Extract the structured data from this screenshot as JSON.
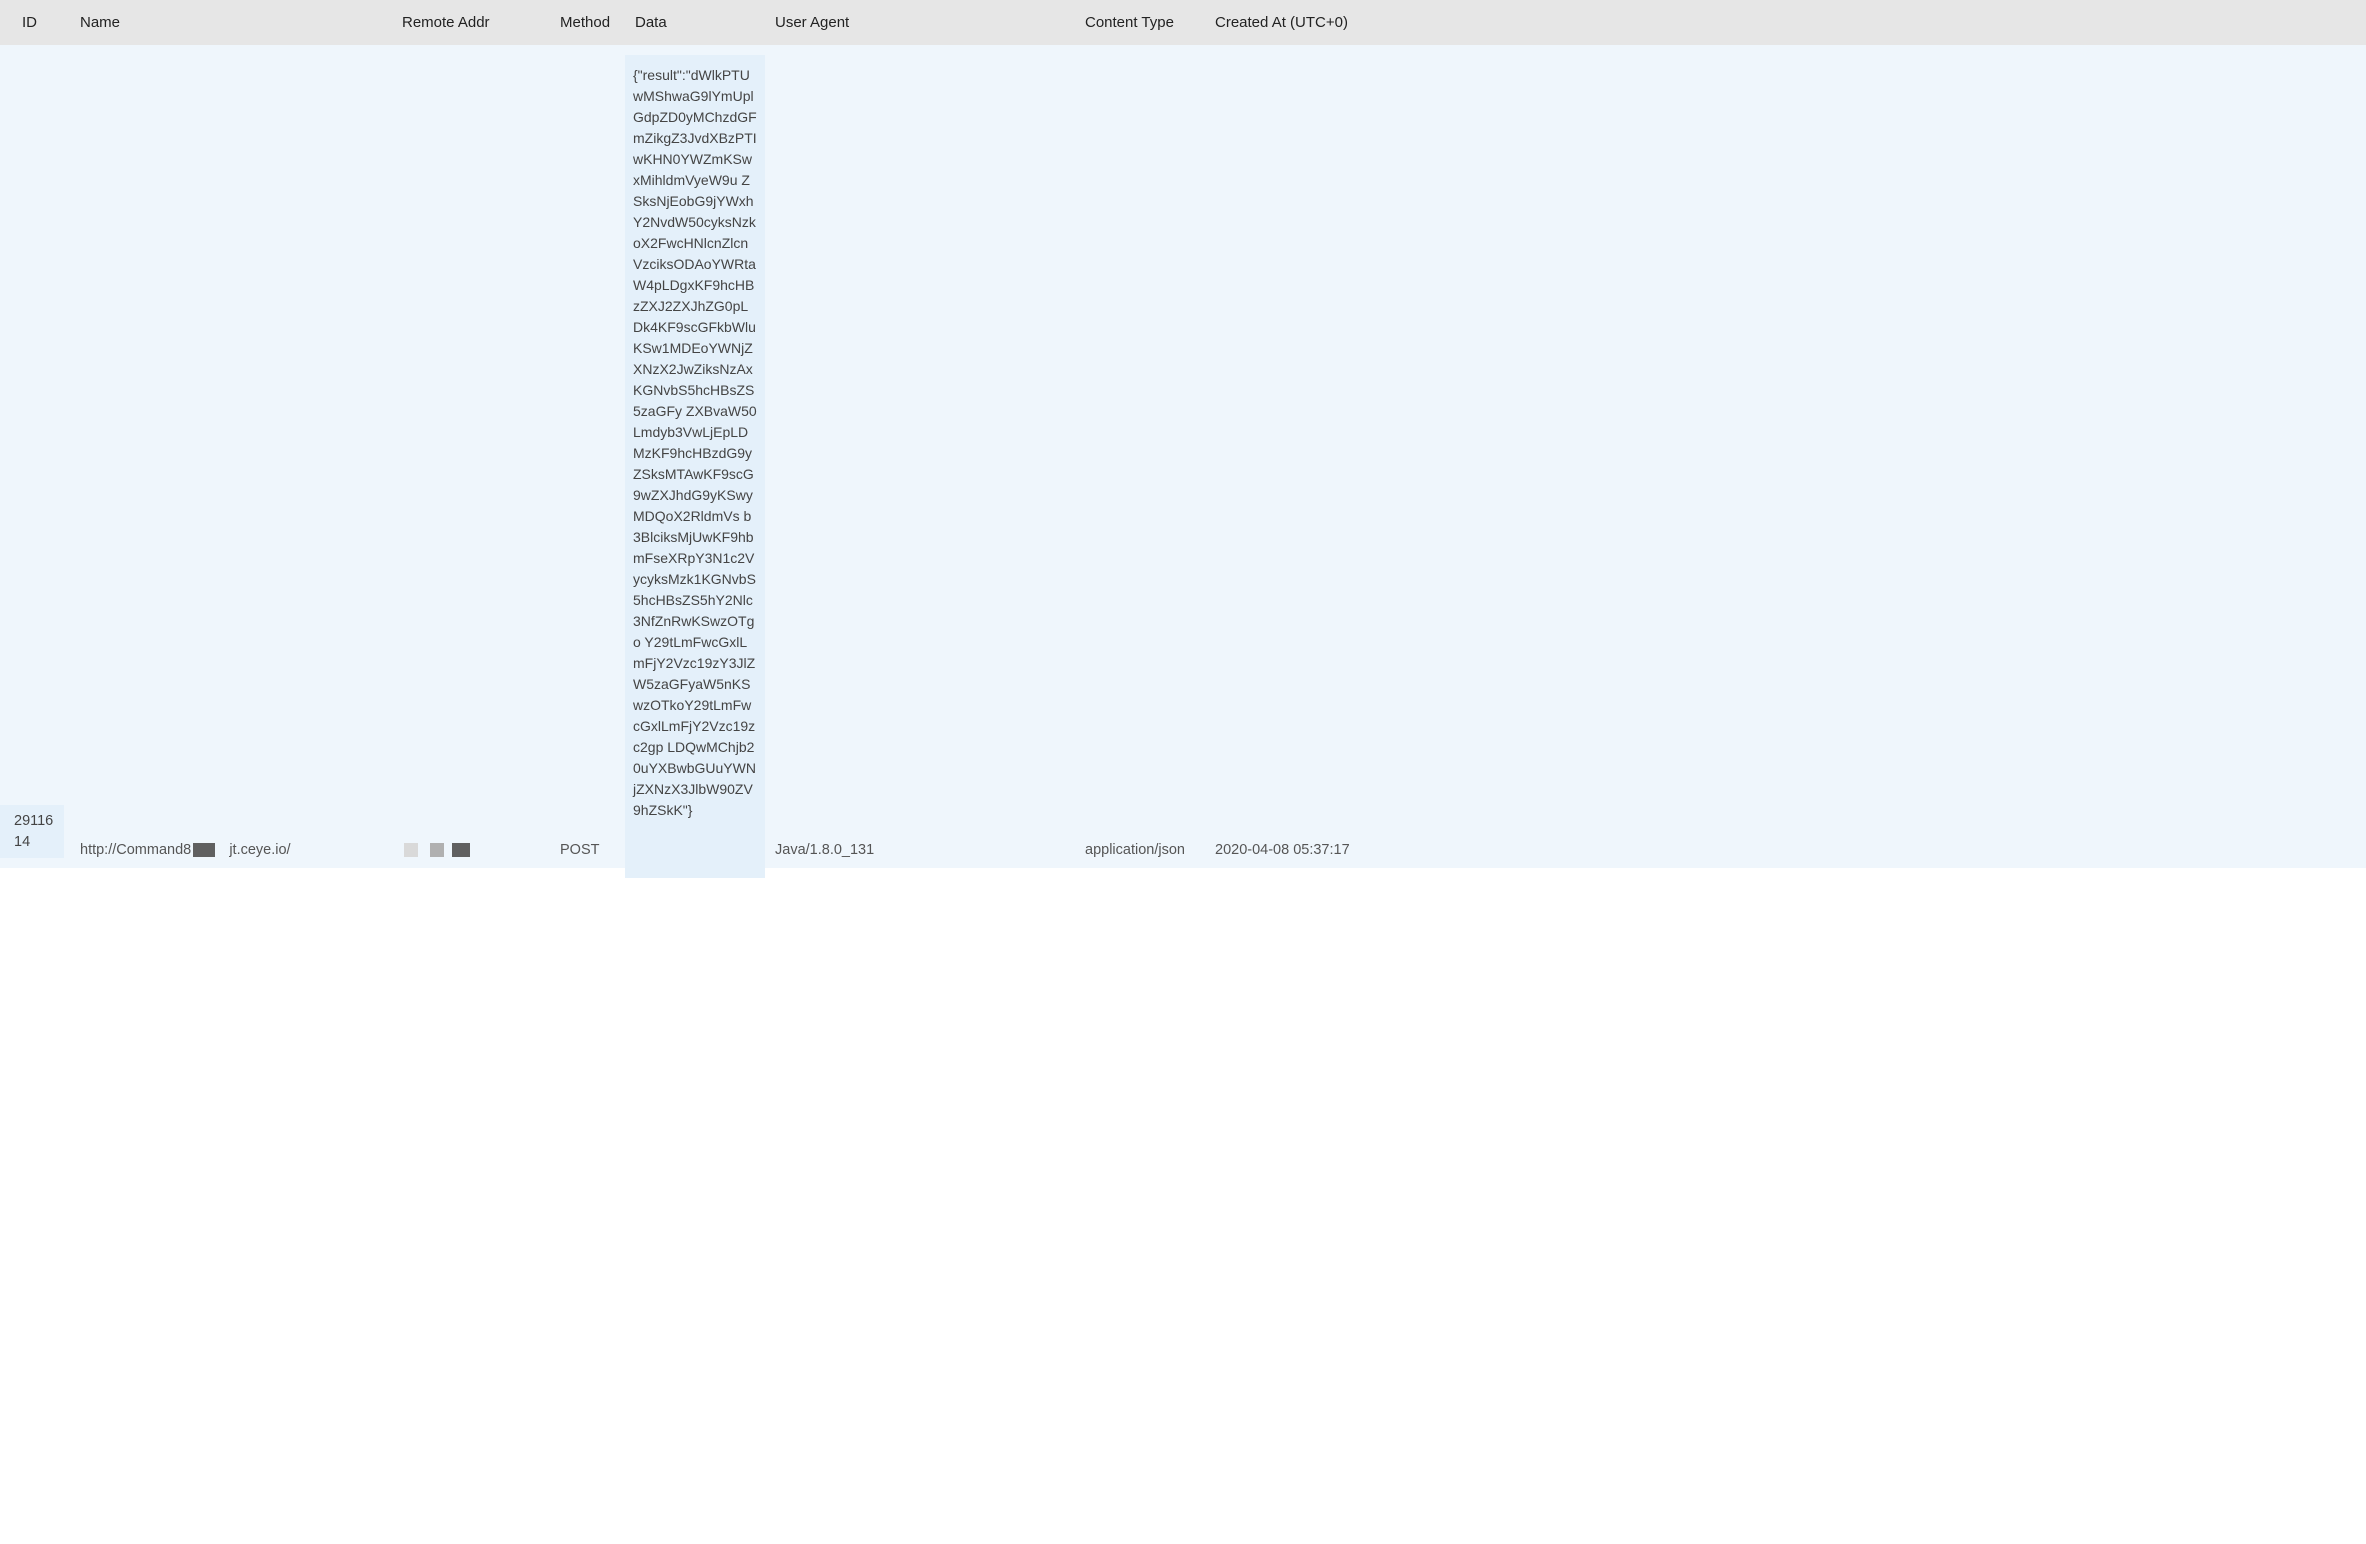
{
  "headers": {
    "id": "ID",
    "name": "Name",
    "remote_addr": "Remote Addr",
    "method": "Method",
    "data": "Data",
    "user_agent": "User Agent",
    "content_type": "Content Type",
    "created_at": "Created At (UTC+0)"
  },
  "rows": [
    {
      "id": "2911614",
      "name_prefix": "http://Command8",
      "name_suffix": "jt.ceye.io/",
      "remote_addr": "",
      "method": "POST",
      "data": "{\"result\":\"dWlkPTUwMShwaG9lYmUplGdpZD0yMChzdGFmZikgZ3JvdXBzPTIwKHN0YWZmKSwxMihldmVyeW9u ZSksNjEobG9jYWxhY2NvdW50cyksNzkoX2FwcHNlcnZlcnVzciksODAoYWRtaW4pLDgxKF9hcHBzZXJ2ZXJhZG0pLDk4KF9scGFkbWluKSw1MDEoYWNjZXNzX2JwZiksNzAxKGNvbS5hcHBsZS5zaGFy ZXBvaW50Lmdyb3VwLjEpLDMzKF9hcHBzdG9yZSksMTAwKF9scG9wZXJhdG9yKSwyMDQoX2RldmVs b3BlciksMjUwKF9hbmFseXRpY3N1c2VycyksMzk1KGNvbS5hcHBsZS5hY2Nlc3NfZnRwKSwzOTgo Y29tLmFwcGxlLmFjY2Vzc19zY3JlZW5zaGFyaW5nKSwzOTkoY29tLmFwcGxlLmFjY2Vzc19zc2gp LDQwMChjb20uYXBwbGUuYWNjZXNzX3JlbW90ZV9hZSkK\"}",
      "user_agent": "Java/1.8.0_131",
      "content_type": "application/json",
      "created_at": "2020-04-08 05:37:17"
    }
  ]
}
